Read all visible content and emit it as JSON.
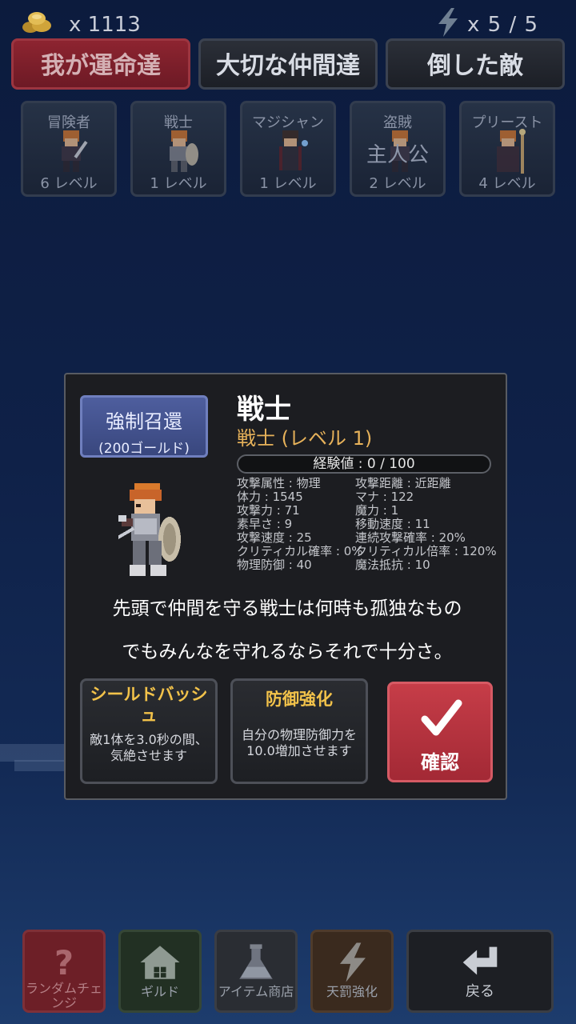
{
  "status": {
    "gold": "x 1113",
    "energy": "x 5 / 5"
  },
  "tabs": [
    {
      "label": "我が運命達",
      "active": true
    },
    {
      "label": "大切な仲間達",
      "active": false
    },
    {
      "label": "倒した敵",
      "active": false
    }
  ],
  "characters": [
    {
      "name": "冒険者",
      "level": "6 レベル",
      "tag": ""
    },
    {
      "name": "戦士",
      "level": "1 レベル",
      "tag": ""
    },
    {
      "name": "マジシャン",
      "level": "1 レベル",
      "tag": ""
    },
    {
      "name": "盗賊",
      "level": "2 レベル",
      "tag": "主人公"
    },
    {
      "name": "プリースト",
      "level": "4 レベル",
      "tag": ""
    }
  ],
  "dialog": {
    "recall_line1": "強制召還",
    "recall_line2": "(200ゴールド)",
    "title": "戦士",
    "subtitle": "戦士 (レベル 1)",
    "exp_text": "経験値 : 0 / 100",
    "exp_progress": 0,
    "stats": [
      [
        "攻撃属性 : 物理",
        "攻撃距離 : 近距離"
      ],
      [
        "体力 : 1545",
        "マナ : 122"
      ],
      [
        "攻撃力 : 71",
        "魔力 : 1"
      ],
      [
        "素早さ : 9",
        "移動速度 : 11"
      ],
      [
        "攻撃速度 : 25",
        "連続攻撃確率 : 20%"
      ],
      [
        "クリティカル確率 : 0%",
        "クリティカル倍率 : 120%"
      ],
      [
        "物理防御 : 40",
        "魔法抵抗 : 10"
      ]
    ],
    "description_line1": "先頭で仲間を守る戦士は何時も孤独なもの",
    "description_line2": "でもみんなを守れるならそれで十分さ。",
    "skill1_name": "シールドバッシュ",
    "skill1_desc": "敵1体を3.0秒の間、気絶させます",
    "skill2_name": "防御強化",
    "skill2_desc": "自分の物理防御力を10.0増加させます",
    "confirm_label": "確認"
  },
  "nav": {
    "random_label": "ランダムチェンジ",
    "guild_label": "ギルド",
    "shop_label": "アイテム商店",
    "punish_label": "天罰強化",
    "back_label": "戻る"
  },
  "colors": {
    "accent_red": "#a32935",
    "recall_blue": "#4e5e9e",
    "skill_gold": "#f2c24a"
  }
}
